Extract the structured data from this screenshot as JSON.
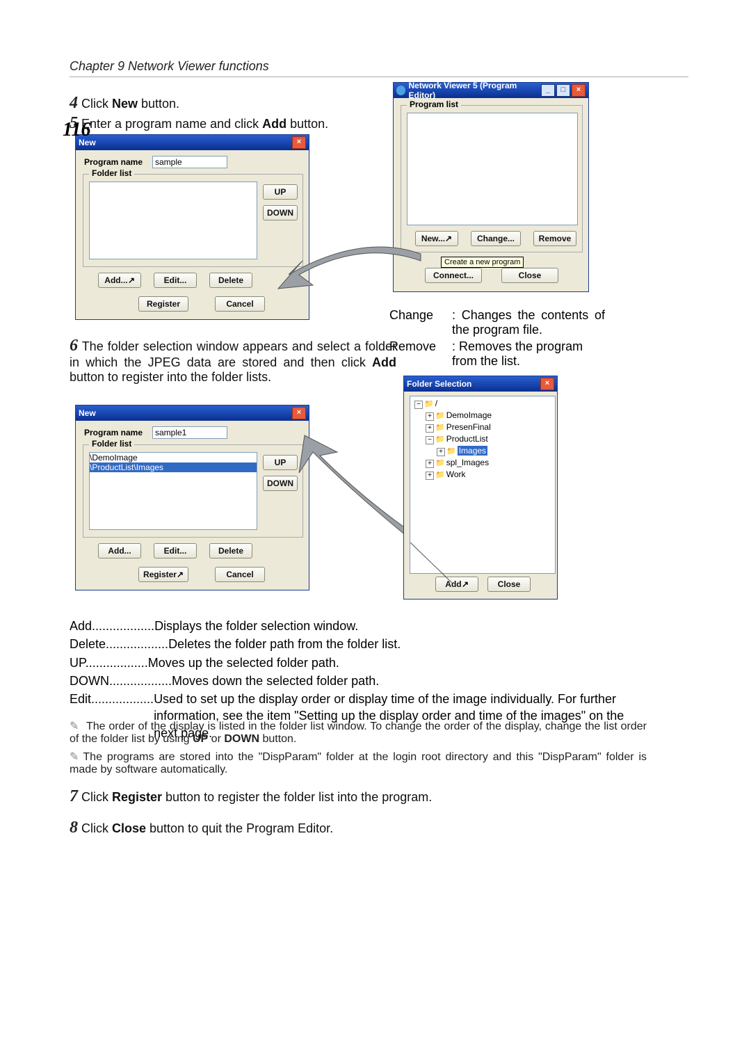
{
  "chapter": "Chapter 9 Network Viewer functions",
  "steps": {
    "s4_num": "4",
    "s4_a": " Click ",
    "s4_b": "New",
    "s4_c": " button.",
    "s5_num": "5",
    "s5_a": " Enter a program name and click ",
    "s5_b": "Add",
    "s5_c": " button.",
    "s6_num": "6",
    "s6_a": "The folder selection window appears and select a folder in which the JPEG data are stored and then click ",
    "s6_b": "Add",
    "s6_c": " button to register into the folder lists.",
    "s7_num": "7",
    "s7_a": " Click ",
    "s7_b": "Register",
    "s7_c": " button to register the folder list into the program.",
    "s8_num": "8",
    "s8_a": " Click ",
    "s8_b": "Close",
    "s8_c": " button to quit the Program Editor."
  },
  "dlg_new1": {
    "title": "New",
    "program_name_lbl": "Program name",
    "program_name_val": "sample",
    "folder_list_lbl": "Folder list",
    "up": "UP",
    "down": "DOWN",
    "add": "Add...",
    "edit": "Edit...",
    "delete": "Delete",
    "register": "Register",
    "cancel": "Cancel"
  },
  "dlg_editor": {
    "title": "Network Viewer 5 (Program Editor)",
    "program_list_lbl": "Program list",
    "new": "New...",
    "change": "Change...",
    "remove": "Remove",
    "tooltip": "Create a new program",
    "connect": "Connect...",
    "close": "Close"
  },
  "editor_desc": {
    "change_lbl": "Change",
    "change_txt": ": Changes the contents of the program file.",
    "remove_lbl": "Remove",
    "remove_txt": ": Removes the program from the list."
  },
  "dlg_new2": {
    "title": "New",
    "program_name_lbl": "Program name",
    "program_name_val": "sample1",
    "folder_list_lbl": "Folder list",
    "folder_items": [
      "\\DemoImage",
      "\\ProductList\\Images"
    ],
    "up": "UP",
    "down": "DOWN",
    "add": "Add...",
    "edit": "Edit...",
    "delete": "Delete",
    "register": "Register",
    "cancel": "Cancel"
  },
  "dlg_folder": {
    "title": "Folder Selection",
    "root": "/",
    "items": [
      "DemoImage",
      "PresenFinal",
      "ProductList",
      "Images",
      "spl_Images",
      "Work"
    ],
    "add": "Add",
    "close": "Close"
  },
  "defs": {
    "add_t": "Add",
    "add_d": "Displays the folder selection window.",
    "del_t": "Delete",
    "del_d": "Deletes the folder path from the folder list.",
    "up_t": "UP",
    "up_d": "Moves up the selected folder path.",
    "down_t": "DOWN",
    "down_d": "Moves down the selected folder path.",
    "edit_t": "Edit",
    "edit_d": "Used to set up the display order or display time of the image individually. For further information, see the item \"Setting up the display order and time of the images\" on the next page."
  },
  "notes": {
    "n1_a": "The order of the display is listed in the folder list window. To change the order of the display, change the list order of the folder list by using ",
    "n1_up": "UP",
    "n1_or": " or ",
    "n1_down": "DOWN",
    "n1_b": " button.",
    "n2": "The programs are stored into the \"DispParam\" folder  at the login root directory and this \"DispParam\" folder is made by software automatically."
  },
  "page_number": "116"
}
